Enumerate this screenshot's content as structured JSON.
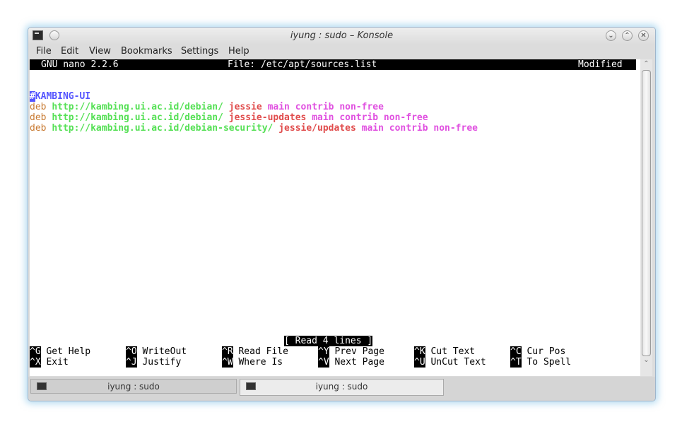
{
  "window": {
    "title": "iyung : sudo – Konsole"
  },
  "menu": [
    "File",
    "Edit",
    "View",
    "Bookmarks",
    "Settings",
    "Help"
  ],
  "nano": {
    "version": "GNU nano 2.2.6",
    "file": "File: /etc/apt/sources.list",
    "state": "Modified",
    "comment_hash": "#",
    "comment_text": "KAMBING-UI",
    "lines": [
      {
        "type": "deb",
        "url": "http://kambing.ui.ac.id/debian/",
        "suite": "jessie",
        "components": "main contrib non-free"
      },
      {
        "type": "deb",
        "url": "http://kambing.ui.ac.id/debian/",
        "suite": "jessie-updates",
        "components": "main contrib non-free"
      },
      {
        "type": "deb",
        "url": "http://kambing.ui.ac.id/debian-security/",
        "suite": "jessie/updates",
        "components": "main contrib non-free"
      }
    ],
    "status": "[ Read 4 lines ]",
    "shortcuts": [
      [
        {
          "key": "^G",
          "label": "Get Help"
        },
        {
          "key": "^O",
          "label": "WriteOut"
        },
        {
          "key": "^R",
          "label": "Read File"
        },
        {
          "key": "^Y",
          "label": "Prev Page"
        },
        {
          "key": "^K",
          "label": "Cut Text"
        },
        {
          "key": "^C",
          "label": "Cur Pos"
        }
      ],
      [
        {
          "key": "^X",
          "label": "Exit"
        },
        {
          "key": "^J",
          "label": "Justify"
        },
        {
          "key": "^W",
          "label": "Where Is"
        },
        {
          "key": "^V",
          "label": "Next Page"
        },
        {
          "key": "^U",
          "label": "UnCut Text"
        },
        {
          "key": "^T",
          "label": "To Spell"
        }
      ]
    ]
  },
  "tabs": [
    {
      "label": "iyung : sudo"
    },
    {
      "label": "iyung : sudo"
    }
  ],
  "colors": {
    "deb": "#c87a32",
    "url": "#55e055",
    "suite": "#e04c4c",
    "components": "#e050e0",
    "comment": "#5555ff",
    "glow": "#78bee6"
  },
  "icons": {
    "app": "terminal-icon",
    "window_buttons": [
      "minimize-icon",
      "maximize-icon",
      "close-icon"
    ]
  }
}
